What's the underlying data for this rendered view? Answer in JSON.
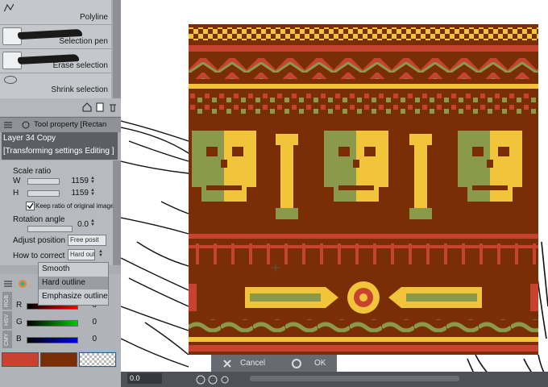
{
  "tool_list": {
    "items": [
      {
        "label": "Polyline"
      },
      {
        "label": "Selection pen"
      },
      {
        "label": "Erase selection"
      },
      {
        "label": "Shrink selection"
      }
    ]
  },
  "tool_property": {
    "title": "Tool property [Rectan",
    "layer_name": "Layer 34 Copy",
    "mode_text": "[Transforming settings Editing ]",
    "scale_ratio_label": "Scale ratio",
    "w_label": "W",
    "w_value": "1159",
    "h_label": "H",
    "h_value": "1159",
    "keep_ratio_label": "Keep ratio of original image",
    "keep_ratio_checked": true,
    "rotation_label": "Rotation angle",
    "rotation_value": "0.0",
    "adjust_position_label": "Adjust position",
    "adjust_position_value": "Free posit",
    "how_to_correct_label": "How to correct",
    "how_to_correct_value": "Hard outl"
  },
  "correct_menu": {
    "options": [
      "Smooth",
      "Hard outline",
      "Emphasize outline"
    ],
    "highlighted": "Hard outline"
  },
  "color_panel": {
    "tab_labels": [
      "RGB",
      "HSV",
      "CMY"
    ],
    "r_label": "R",
    "r_value": "0",
    "g_label": "G",
    "g_value": "0",
    "b_label": "B",
    "b_value": "0",
    "colors": {
      "main": "#c8432f",
      "sub": "#7a2e06",
      "transparent": "checker"
    }
  },
  "confirm_bar": {
    "cancel_label": "Cancel",
    "ok_label": "OK"
  },
  "status_bar": {
    "zoom": "0.0"
  },
  "palette": {
    "brown": "#7a2e06",
    "red": "#c8432f",
    "yellow": "#f2c43a",
    "green": "#8a9a4a",
    "panel": "#a9adb3"
  }
}
